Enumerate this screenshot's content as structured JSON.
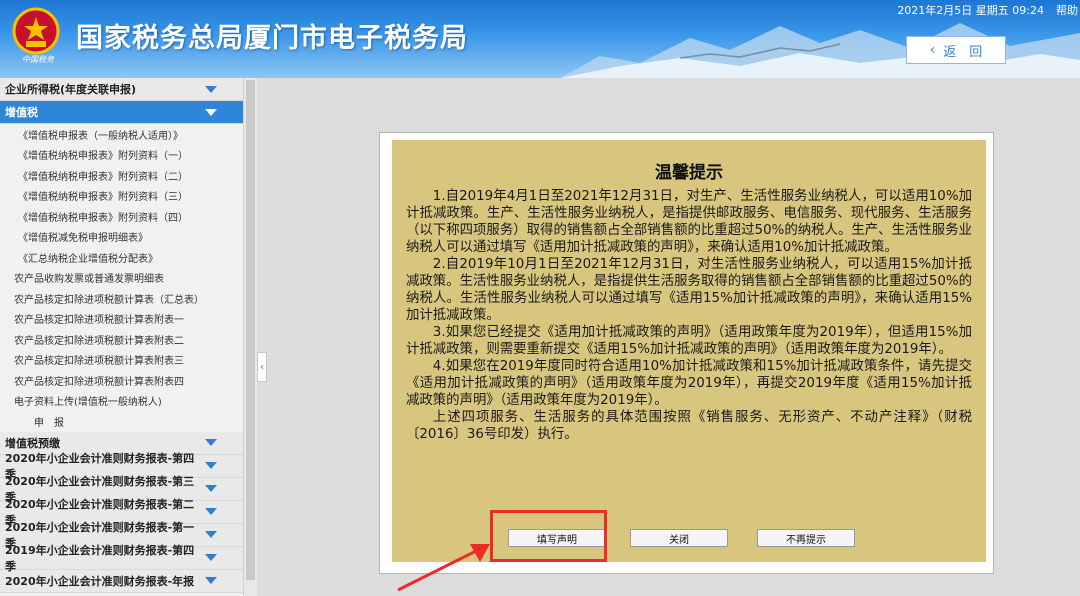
{
  "header": {
    "title": "国家税务总局厦门市电子税务局",
    "emblem_text": "中国税务",
    "datetime": "2021年2月5日 星期五 09:24",
    "help": "帮助",
    "back_label": "返　回"
  },
  "sidebar": {
    "section1": "企业所得税(年度关联申报)",
    "section_active": "增值税",
    "sub_items": [
      "《增值税申报表（一般纳税人适用）》",
      "《增值税纳税申报表》附列资料（一）",
      "《增值税纳税申报表》附列资料（二）",
      "《增值税纳税申报表》附列资料（三）",
      "《增值税纳税申报表》附列资料（四）",
      "《增值税减免税申报明细表》",
      "《汇总纳税企业增值税分配表》",
      "农产品收购发票或普通发票明细表",
      "农产品核定扣除进项税额计算表（汇总表）",
      "农产品核定扣除进项税额计算表附表一",
      "农产品核定扣除进项税额计算表附表二",
      "农产品核定扣除进项税额计算表附表三",
      "农产品核定扣除进项税额计算表附表四",
      "电子资料上传(增值税一般纳税人)"
    ],
    "submit_label": "申报",
    "sections_after": [
      "增值税预缴",
      "2020年小企业会计准则财务报表-第四季",
      "2020年小企业会计准则财务报表-第三季",
      "2020年小企业会计准则财务报表-第二季",
      "2020年小企业会计准则财务报表-第一季",
      "2019年小企业会计准则财务报表-第四季",
      "2020年小企业会计准则财务报表-年报"
    ]
  },
  "dialog": {
    "title": "温馨提示",
    "paragraphs": [
      "1.自2019年4月1日至2021年12月31日，对生产、生活性服务业纳税人，可以适用10%加计抵减政策。生产、生活性服务业纳税人，是指提供邮政服务、电信服务、现代服务、生活服务（以下称四项服务）取得的销售额占全部销售额的比重超过50%的纳税人。生产、生活性服务业纳税人可以通过填写《适用加计抵减政策的声明》，来确认适用10%加计抵减政策。",
      "2.自2019年10月1日至2021年12月31日，对生活性服务业纳税人，可以适用15%加计抵减政策。生活性服务业纳税人，是指提供生活服务取得的销售额占全部销售额的比重超过50%的纳税人。生活性服务业纳税人可以通过填写《适用15%加计抵减政策的声明》，来确认适用15%加计抵减政策。",
      "3.如果您已经提交《适用加计抵减政策的声明》（适用政策年度为2019年），但适用15%加计抵减政策，则需要重新提交《适用15%加计抵减政策的声明》（适用政策年度为2019年）。",
      "4.如果您在2019年度同时符合适用10%加计抵减政策和15%加计抵减政策条件，请先提交《适用加计抵减政策的声明》（适用政策年度为2019年），再提交2019年度《适用15%加计抵减政策的声明》（适用政策年度为2019年）。",
      "上述四项服务、生活服务的具体范围按照《销售服务、无形资产、不动产注释》（财税〔2016〕36号印发）执行。"
    ],
    "buttons": {
      "fill": "填写声明",
      "close": "关闭",
      "no_more": "不再提示"
    }
  },
  "colors": {
    "header_blue": "#2f86d9",
    "dialog_bg": "#d8c67e",
    "highlight_red": "#ee2a2a"
  }
}
